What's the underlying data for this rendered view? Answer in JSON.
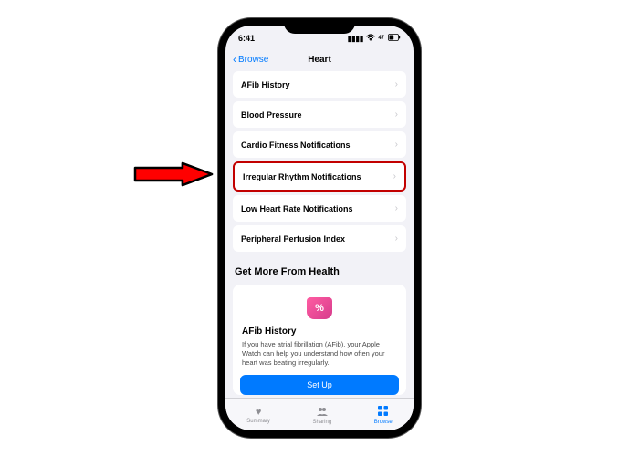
{
  "status_bar": {
    "time": "6:41",
    "battery": "47"
  },
  "nav": {
    "back_label": "Browse",
    "title": "Heart"
  },
  "list": {
    "items": [
      {
        "label": "AFib History"
      },
      {
        "label": "Blood Pressure"
      },
      {
        "label": "Cardio Fitness Notifications"
      },
      {
        "label": "Irregular Rhythm Notifications"
      },
      {
        "label": "Low Heart Rate Notifications"
      },
      {
        "label": "Peripheral Perfusion Index"
      }
    ]
  },
  "promo": {
    "section_header": "Get More From Health",
    "icon_glyph": "%",
    "title": "AFib History",
    "description": "If you have atrial fibrillation (AFib), your Apple Watch can help you understand how often your heart was beating irregularly.",
    "button": "Set Up"
  },
  "tabs": {
    "items": [
      {
        "label": "Summary"
      },
      {
        "label": "Sharing"
      },
      {
        "label": "Browse"
      }
    ]
  }
}
